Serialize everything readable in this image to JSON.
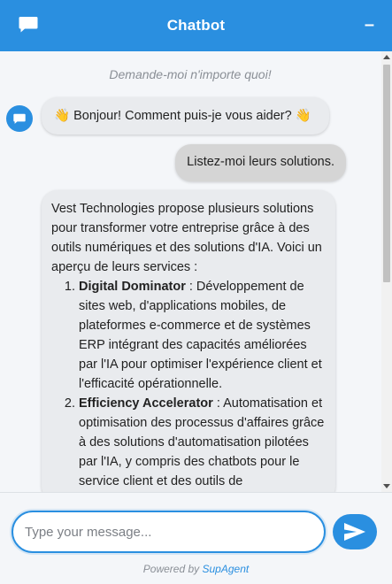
{
  "header": {
    "title": "Chatbot",
    "minimize_label": "–",
    "chat_icon": "chat-bubble-icon"
  },
  "conversation": {
    "intro": "Demande-moi n'importe quoi!",
    "greeting": "👋 Bonjour! Comment puis-je vous aider? 👋",
    "user_message": "Listez-moi leurs solutions.",
    "answer": {
      "intro": "Vest Technologies propose plusieurs solutions pour transformer votre entreprise grâce à des outils numériques et des solutions d'IA. Voici un aperçu de leurs services :",
      "items": [
        {
          "name": "Digital Dominator",
          "text": " : Développement de sites web, d'applications mobiles, de plateformes e-commerce et de systèmes ERP intégrant des capacités améliorées par l'IA pour optimiser l'expérience client et l'efficacité opérationnelle."
        },
        {
          "name": "Efficiency Accelerator",
          "text": " : Automatisation et optimisation des processus d'affaires grâce à des solutions d'automatisation pilotées par l'IA, y compris des chatbots pour le service client et des outils de"
        }
      ]
    }
  },
  "input": {
    "placeholder": "Type your message...",
    "value": ""
  },
  "footer": {
    "powered_by": "Powered by ",
    "brand": "SupAgent"
  },
  "colors": {
    "accent": "#2a8fe0",
    "bot_bubble": "#e9ebee",
    "user_bubble": "#d5d5d5",
    "background": "#f4f6f9"
  }
}
